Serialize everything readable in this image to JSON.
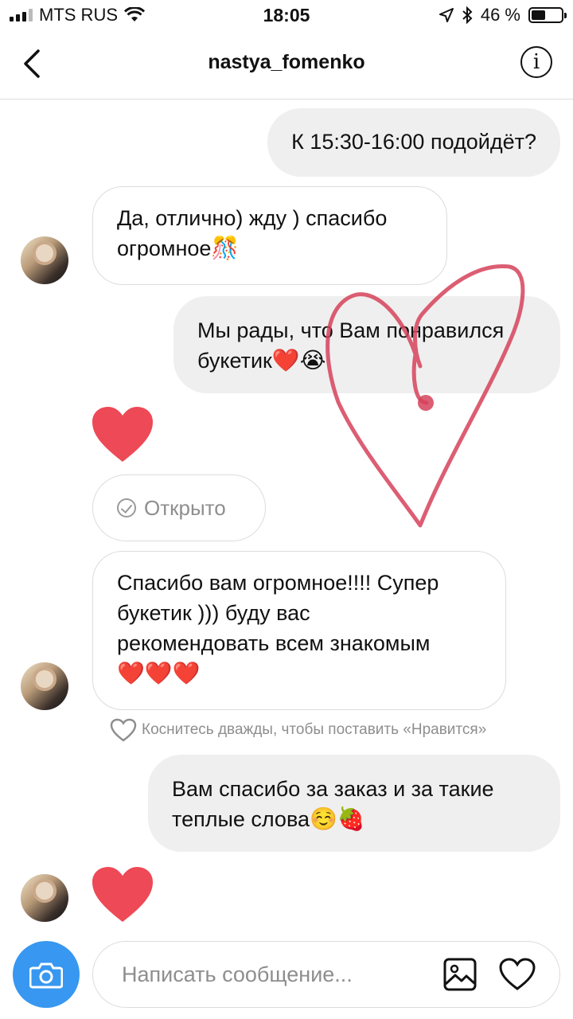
{
  "status_bar": {
    "carrier": "MTS RUS",
    "time": "18:05",
    "battery_percent": "46 %",
    "battery_level": 0.46
  },
  "header": {
    "username": "nastya_fomenko",
    "info_label": "i"
  },
  "messages": [
    {
      "direction": "out",
      "text": "К 15:30-16:00 подойдёт?"
    },
    {
      "direction": "in",
      "text": "Да, отлично) жду ) спасибо",
      "text2": "огромное",
      "emoji": "🎊"
    },
    {
      "direction": "out",
      "text": "Мы рады, что Вам понравился",
      "text2": "букетик",
      "emoji": "❤️😭"
    },
    {
      "direction": "out",
      "type": "heart-reaction"
    },
    {
      "direction": "in",
      "text": "Спасибо вам огромное!!!! Супер",
      "text2": "букетик ))) буду вас",
      "text3": "рекомендовать всем знакомым",
      "emoji": "❤️❤️❤️"
    },
    {
      "direction": "out",
      "text": "Вам спасибо за заказ и за такие",
      "text2": "теплые слова",
      "emoji": "☺️🍓"
    },
    {
      "direction": "in",
      "type": "heart-reaction"
    }
  ],
  "seen_label": "Открыто",
  "like_hint": "Коснитесь дважды, чтобы поставить «Нравится»",
  "composer": {
    "placeholder": "Написать сообщение..."
  },
  "colors": {
    "accent": "#3897f0",
    "heart": "#ed4956",
    "bubble_out": "#efefef",
    "drawn_heart": "#d6425a"
  }
}
